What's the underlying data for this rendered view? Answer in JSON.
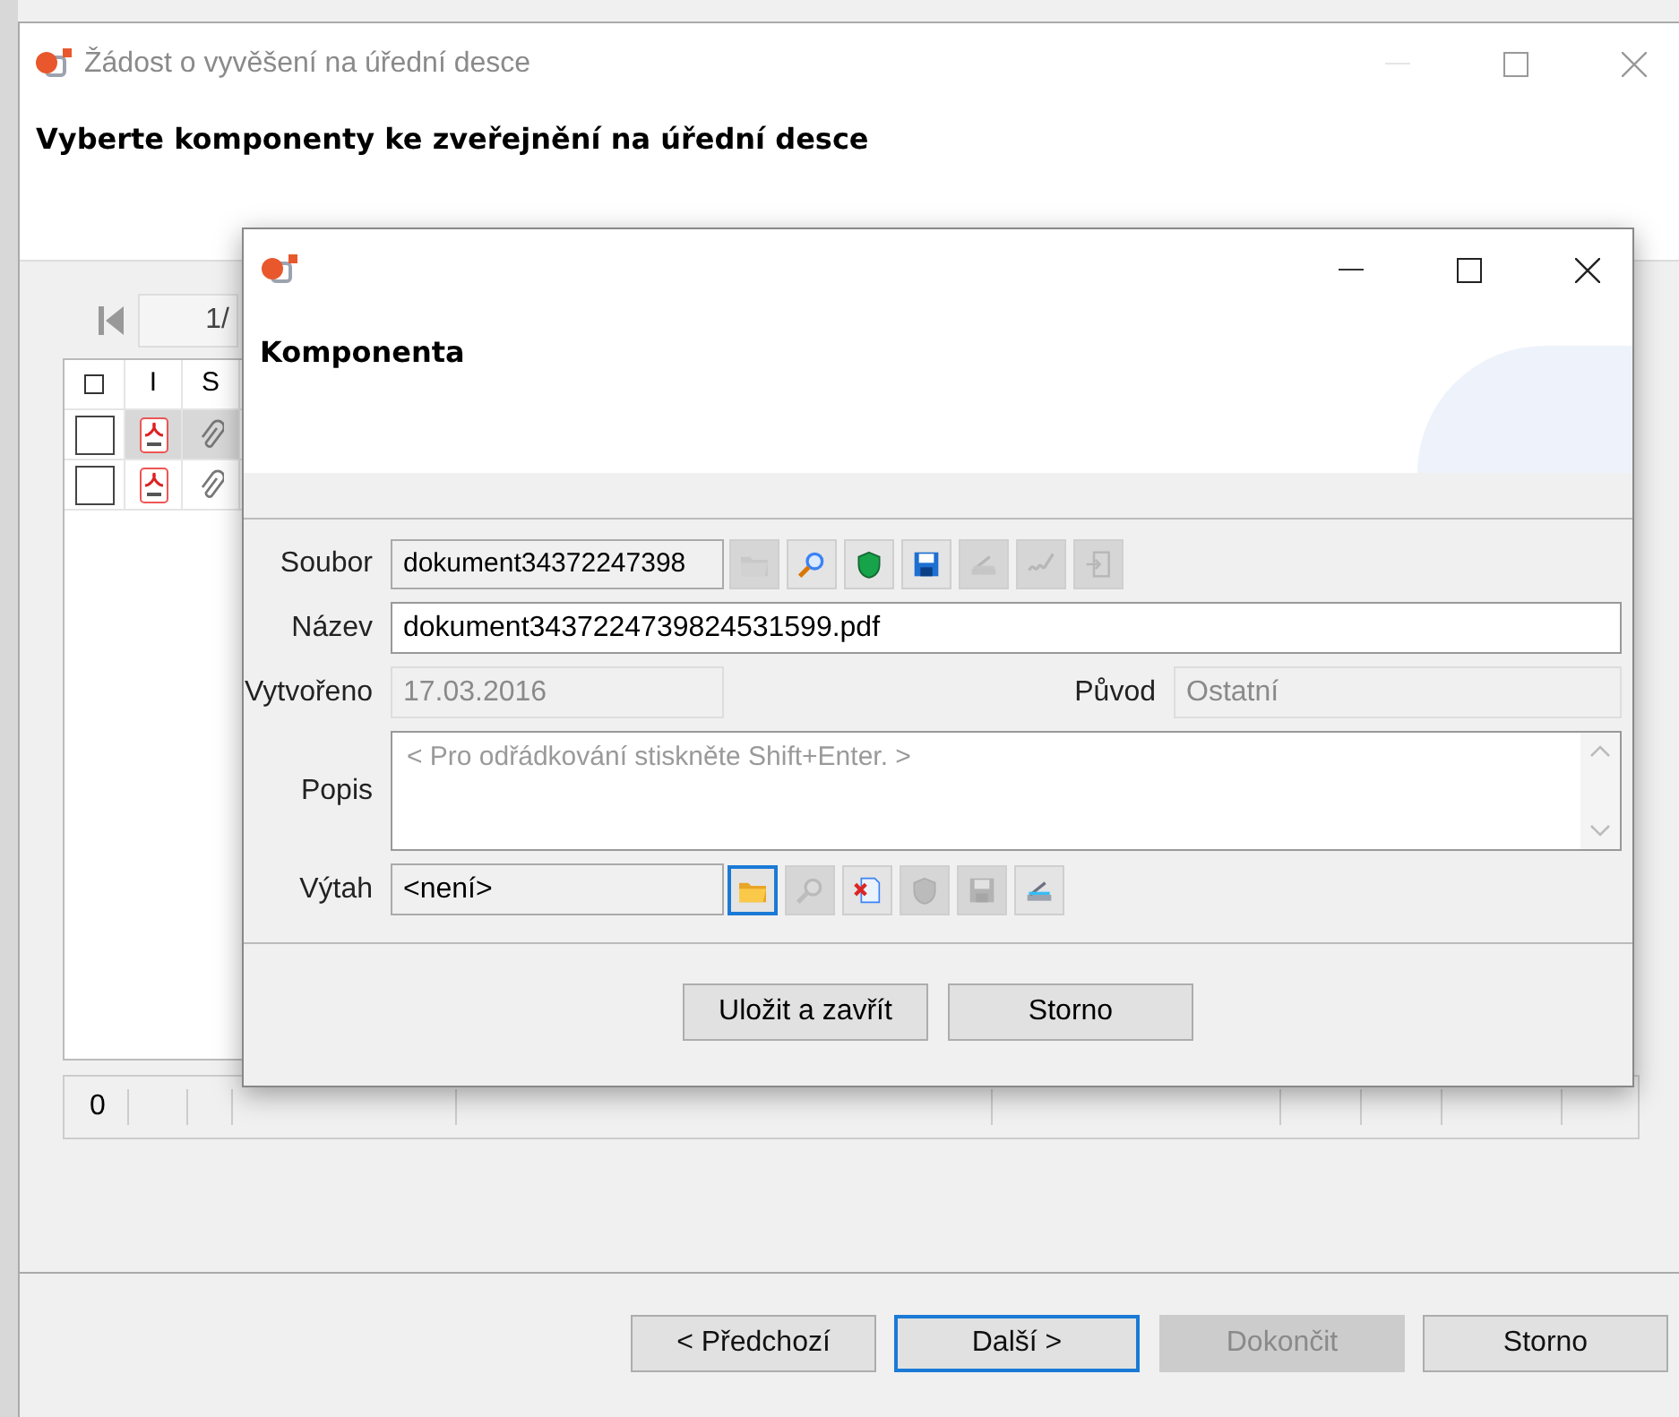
{
  "outer_window": {
    "title": "Žádost o vyvěšení na úřední desce",
    "heading": "Vyberte komponenty ke zveřejnění na úřední desce"
  },
  "pager": {
    "page": "1/"
  },
  "table": {
    "columns": [
      {
        "kind": "checkbox"
      },
      {
        "label": "I"
      },
      {
        "label": "S"
      }
    ],
    "select_all": {
      "checked": false
    },
    "rows": [
      {
        "checked": false,
        "selected": true
      },
      {
        "checked": false,
        "selected": false
      }
    ]
  },
  "footer_bar": {
    "count": "0"
  },
  "wizard_buttons": [
    {
      "label": "< Předchozí",
      "disabled": false,
      "focused": false
    },
    {
      "label": "Další >",
      "disabled": false,
      "focused": true
    },
    {
      "label": "Dokončit",
      "disabled": true,
      "focused": false
    },
    {
      "label": "Storno",
      "disabled": false,
      "focused": false
    }
  ],
  "dialog": {
    "heading": "Komponenta",
    "soubor": {
      "label": "Soubor",
      "value": "dokument34372247398",
      "tools": [
        {
          "kind": "folder",
          "disabled": true,
          "focused": false
        },
        {
          "kind": "magnifier",
          "disabled": false,
          "focused": false
        },
        {
          "kind": "shield",
          "disabled": false,
          "focused": false
        },
        {
          "kind": "save",
          "disabled": false,
          "focused": false
        },
        {
          "kind": "scanner",
          "disabled": true,
          "focused": false
        },
        {
          "kind": "signature",
          "disabled": true,
          "focused": false
        },
        {
          "kind": "export",
          "disabled": true,
          "focused": false
        }
      ]
    },
    "nazev": {
      "label": "Název",
      "value": "dokument3437224739824531599.pdf"
    },
    "vytvoreno": {
      "label": "Vytvořeno",
      "value": "17.03.2016",
      "disabled": true
    },
    "puvod": {
      "label": "Původ",
      "value": "Ostatní",
      "disabled": true
    },
    "popis": {
      "label": "Popis",
      "placeholder": "< Pro odřádkování stiskněte Shift+Enter. >"
    },
    "vytah": {
      "label": "Výtah",
      "value": "<není>",
      "tools": [
        {
          "kind": "folder",
          "disabled": false,
          "focused": true
        },
        {
          "kind": "magnifier",
          "disabled": true,
          "focused": false
        },
        {
          "kind": "delete",
          "disabled": false,
          "focused": false
        },
        {
          "kind": "shield",
          "disabled": true,
          "focused": false
        },
        {
          "kind": "save",
          "disabled": true,
          "focused": false
        },
        {
          "kind": "scanner",
          "disabled": false,
          "focused": false
        }
      ]
    },
    "buttons": [
      {
        "label": "Uložit a zavřít"
      },
      {
        "label": "Storno"
      }
    ]
  }
}
